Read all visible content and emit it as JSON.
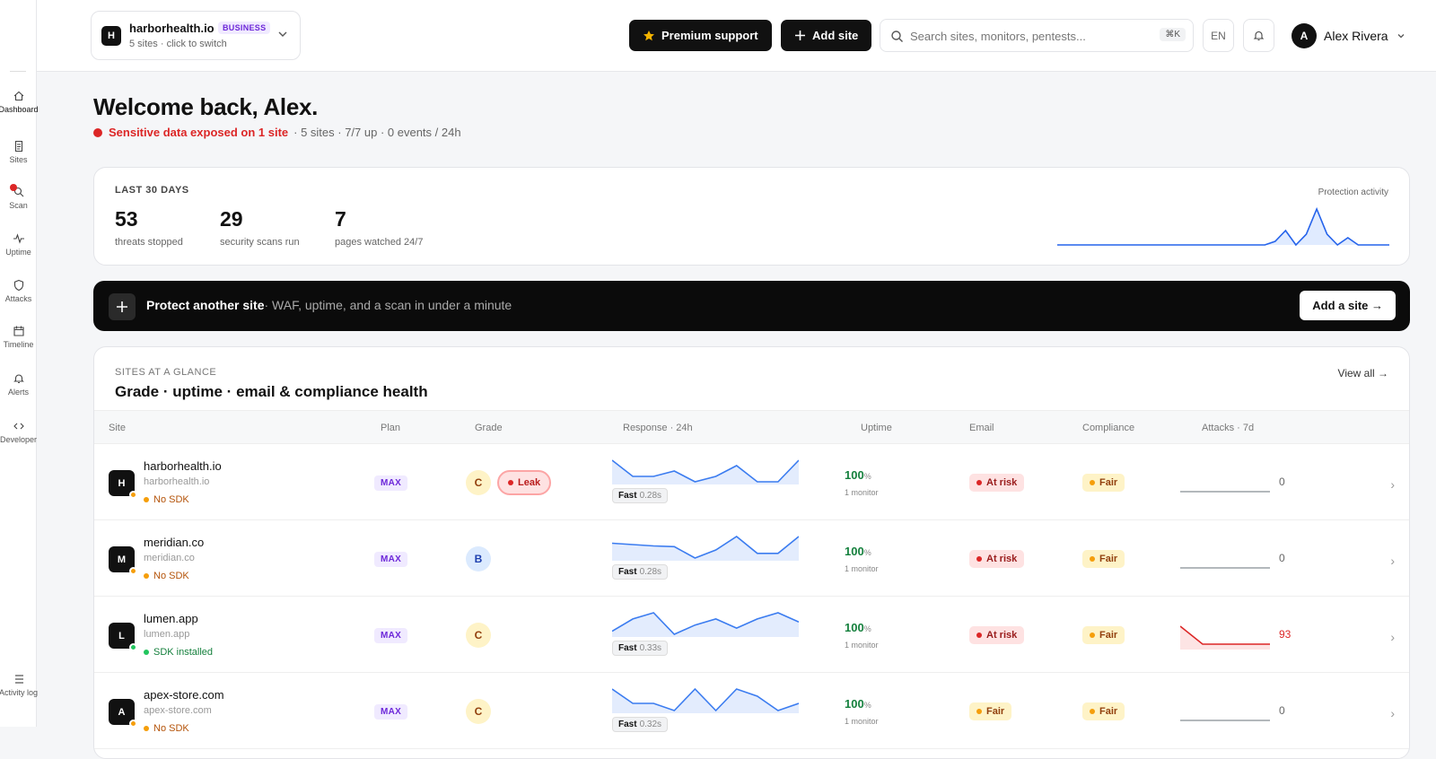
{
  "sidebar": {
    "items": [
      {
        "label": "Dashboard",
        "icon": "home-icon",
        "active": true
      },
      {
        "label": "Sites",
        "icon": "file-icon"
      },
      {
        "label": "Scan",
        "icon": "search-icon",
        "badge": true
      },
      {
        "label": "Uptime",
        "icon": "pulse-icon"
      },
      {
        "label": "Attacks",
        "icon": "shield-icon"
      },
      {
        "label": "Timeline",
        "icon": "calendar-icon"
      },
      {
        "label": "Alerts",
        "icon": "bell-icon"
      },
      {
        "label": "Developer",
        "icon": "code-icon"
      }
    ],
    "activity_log": "Activity log"
  },
  "header": {
    "workspace": {
      "logo": "H",
      "name": "harborhealth.io",
      "badge": "BUSINESS",
      "sub": "5 sites · click to switch"
    },
    "premium_label": "Premium support",
    "add_site_label": "Add site",
    "search": {
      "placeholder": "Search sites, monitors, pentests...",
      "shortcut": "⌘K"
    },
    "lang": "EN",
    "user": {
      "initial": "A",
      "name": "Alex Rivera"
    }
  },
  "welcome": {
    "title": "Welcome back, Alex.",
    "alert": "Sensitive data exposed on 1 site",
    "summary": "· 5 sites · 7/7 up · 0 events / 24h"
  },
  "stats": {
    "kicker": "LAST 30 DAYS",
    "items": [
      {
        "value": "53",
        "label": "threats stopped"
      },
      {
        "value": "29",
        "label": "security scans run"
      },
      {
        "value": "7",
        "label": "pages watched 24/7"
      }
    ],
    "activity_label": "Protection activity",
    "activity_values": [
      0,
      0,
      0,
      0,
      0,
      0,
      0,
      0,
      0,
      0,
      0,
      0,
      0,
      0,
      0,
      0,
      0,
      0,
      0,
      0,
      0,
      1,
      4,
      0,
      3,
      10,
      3,
      0,
      2,
      0,
      0,
      0,
      0
    ]
  },
  "cta": {
    "title": "Protect another site",
    "sub": "· WAF, uptime, and a scan in under a minute",
    "button": "Add a site →"
  },
  "sites": {
    "kicker": "SITES AT A GLANCE",
    "title": "Grade · uptime · email & compliance health",
    "view_all": "View all →",
    "columns": [
      "Site",
      "Plan",
      "Grade",
      "Response · 24h",
      "Uptime",
      "Email",
      "Compliance",
      "Attacks · 7d"
    ],
    "rows": [
      {
        "logo": "H",
        "name": "harborhealth.io",
        "host": "harborhealth.io",
        "sdk": "No SDK",
        "sdk_color": "#f59e0b",
        "sdk_text_color": "#b45309",
        "plan": "MAX",
        "grade": "C",
        "grade_bg": "#fef3c7",
        "grade_color": "#92400e",
        "leak": "Leak",
        "response": [
          5,
          2,
          2,
          3,
          1,
          2,
          4,
          1,
          1,
          5
        ],
        "speed": "Fast",
        "time": "0.28s",
        "uptime": "100",
        "uptime_unit": "%",
        "monitors": "1 monitor",
        "email": "At risk",
        "email_kind": "risk",
        "compliance": "Fair",
        "compliance_kind": "fair",
        "attacks": [
          0,
          0,
          0,
          0,
          0
        ],
        "attacks_total": "0"
      },
      {
        "logo": "M",
        "name": "meridian.co",
        "host": "meridian.co",
        "sdk": "No SDK",
        "sdk_color": "#f59e0b",
        "sdk_text_color": "#b45309",
        "plan": "MAX",
        "grade": "B",
        "grade_bg": "#dbeafe",
        "grade_color": "#1e40af",
        "response": [
          4,
          3.8,
          3.6,
          3.5,
          1.8,
          3,
          5,
          2.5,
          2.5,
          5
        ],
        "speed": "Fast",
        "time": "0.28s",
        "uptime": "100",
        "uptime_unit": "%",
        "monitors": "1 monitor",
        "email": "At risk",
        "email_kind": "risk",
        "compliance": "Fair",
        "compliance_kind": "fair",
        "attacks": [
          0,
          0,
          0,
          0,
          0
        ],
        "attacks_total": "0"
      },
      {
        "logo": "L",
        "name": "lumen.app",
        "host": "lumen.app",
        "sdk": "SDK installed",
        "sdk_color": "#22c55e",
        "sdk_text_color": "#15803d",
        "plan": "MAX",
        "grade": "C",
        "grade_bg": "#fef3c7",
        "grade_color": "#92400e",
        "response": [
          2,
          4,
          5,
          1.5,
          3,
          4,
          2.5,
          4,
          5,
          3.5
        ],
        "speed": "Fast",
        "time": "0.33s",
        "uptime": "100",
        "uptime_unit": "%",
        "monitors": "1 monitor",
        "email": "At risk",
        "email_kind": "risk",
        "compliance": "Fair",
        "compliance_kind": "fair",
        "attacks": [
          93,
          8,
          8,
          8,
          8
        ],
        "attacks_total": "93"
      },
      {
        "logo": "A",
        "name": "apex-store.com",
        "host": "apex-store.com",
        "sdk": "No SDK",
        "sdk_color": "#f59e0b",
        "sdk_text_color": "#b45309",
        "plan": "MAX",
        "grade": "C",
        "grade_bg": "#fef3c7",
        "grade_color": "#92400e",
        "response": [
          5,
          3,
          3,
          2,
          5,
          2,
          5,
          4,
          2,
          3
        ],
        "speed": "Fast",
        "time": "0.32s",
        "uptime": "100",
        "uptime_unit": "%",
        "monitors": "1 monitor",
        "email": "Fair",
        "email_kind": "fair",
        "compliance": "Fair",
        "compliance_kind": "fair",
        "attacks": [
          0,
          0,
          0,
          0,
          0
        ],
        "attacks_total": "0"
      }
    ]
  }
}
